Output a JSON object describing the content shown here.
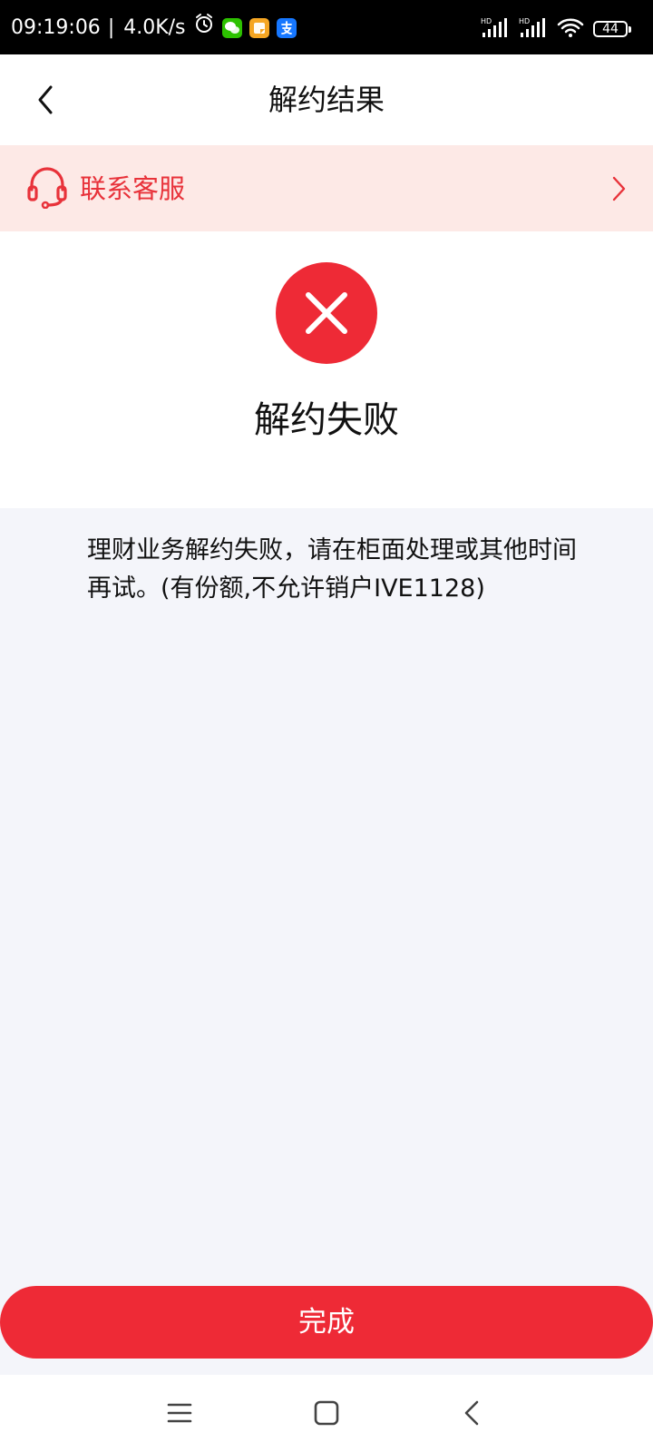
{
  "status_bar": {
    "time": "09:19:06",
    "network_speed": "4.0K/s",
    "battery": "44",
    "icons": [
      "alarm-icon",
      "wechat-icon",
      "notes-app-icon",
      "alipay-icon",
      "hd-signal-icon",
      "hd-signal-icon",
      "wifi-icon",
      "battery-icon"
    ]
  },
  "header": {
    "title": "解约结果",
    "back_icon": "chevron-left-icon"
  },
  "service_banner": {
    "label": "联系客服",
    "icon": "headset-icon",
    "arrow_icon": "chevron-right-icon"
  },
  "result": {
    "icon": "close-circle-icon",
    "title": "解约失败",
    "message": "理财业务解约失败，请在柜面处理或其他时间再试。(有份额,不允许销户IVE1128)"
  },
  "actions": {
    "done_label": "完成"
  },
  "nav_bar": {
    "icons": [
      "menu-icon",
      "home-icon",
      "back-icon"
    ]
  },
  "colors": {
    "accent": "#ee2a36",
    "banner_background": "#fde9e6",
    "page_background": "#f4f5fa"
  }
}
